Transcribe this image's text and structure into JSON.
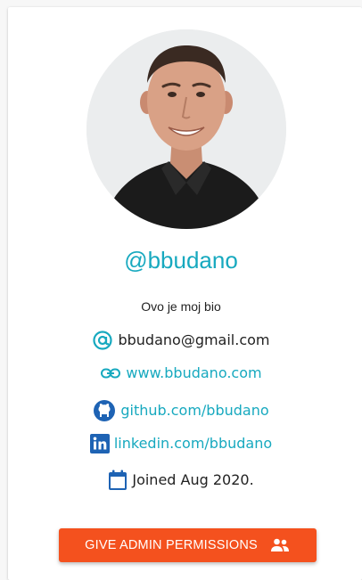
{
  "profile": {
    "username": "@bbudano",
    "bio": "Ovo je moj bio",
    "avatar_icon": "user-photo-avatar"
  },
  "contacts": {
    "email": {
      "icon": "at-sign-icon",
      "text": "bbudano@gmail.com"
    },
    "website": {
      "icon": "link-icon",
      "text": "www.bbudano.com"
    },
    "github": {
      "icon": "github-icon",
      "text": "github.com/bbudano"
    },
    "linkedin": {
      "icon": "linkedin-icon",
      "text": "linkedin.com/bbudano"
    },
    "joined": {
      "icon": "calendar-icon",
      "text": "Joined Aug 2020."
    }
  },
  "actions": {
    "admin_button": {
      "label": "GIVE ADMIN PERMISSIONS",
      "icon": "people-icon"
    }
  },
  "colors": {
    "accent": "#17a9bf",
    "button": "#f4511e",
    "text": "#222222"
  }
}
